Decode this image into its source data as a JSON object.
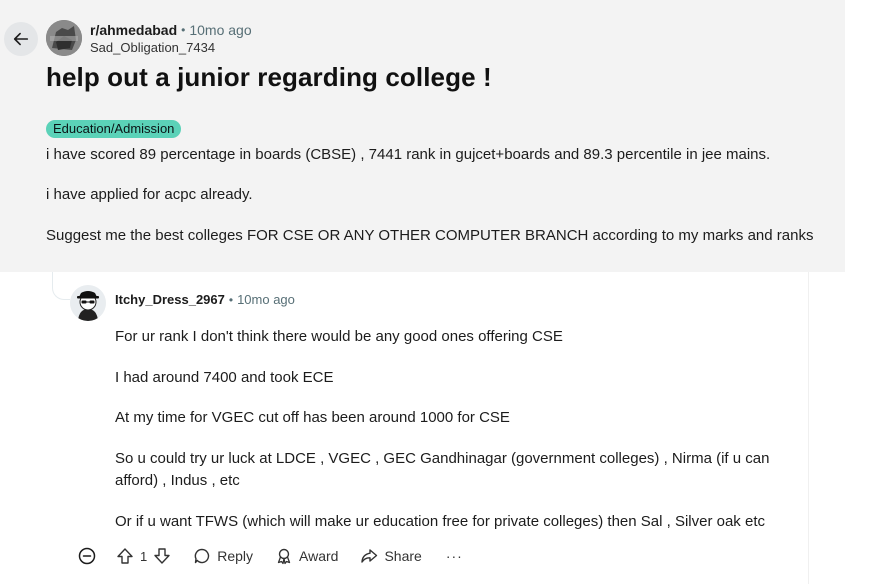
{
  "post": {
    "subreddit": "r/ahmedabad",
    "time": "10mo ago",
    "author": "Sad_Obligation_7434",
    "title": "help out a junior regarding college !",
    "flair": "Education/Admission",
    "body": [
      "i have scored 89 percentage in boards (CBSE) , 7441 rank in gujcet+boards and 89.3 percentile in jee mains.",
      "i have applied for acpc already.",
      "Suggest me the best colleges FOR CSE OR ANY OTHER COMPUTER BRANCH according to my marks and ranks"
    ]
  },
  "comment": {
    "author": "Itchy_Dress_2967",
    "time": "10mo ago",
    "paragraphs": [
      "For ur rank I don't think there would be any good ones offering CSE",
      "I had around 7400 and took ECE",
      "At my time for VGEC cut off has been around 1000 for CSE",
      "So u could try ur luck at LDCE , VGEC , GEC Gandhinagar (government colleges) , Nirma (if u can afford) , Indus , etc",
      "Or if u want TFWS (which will make ur education free for private colleges) then Sal , Silver oak etc"
    ],
    "votes": "1",
    "actions": {
      "reply": "Reply",
      "award": "Award",
      "share": "Share",
      "more": "···"
    }
  },
  "icons": {
    "back": "arrow-left-icon",
    "collapse": "minus-circle-icon",
    "upvote": "arrow-up-icon",
    "downvote": "arrow-down-icon",
    "reply": "speech-bubble-icon",
    "award": "award-icon",
    "share": "share-arrow-icon"
  }
}
